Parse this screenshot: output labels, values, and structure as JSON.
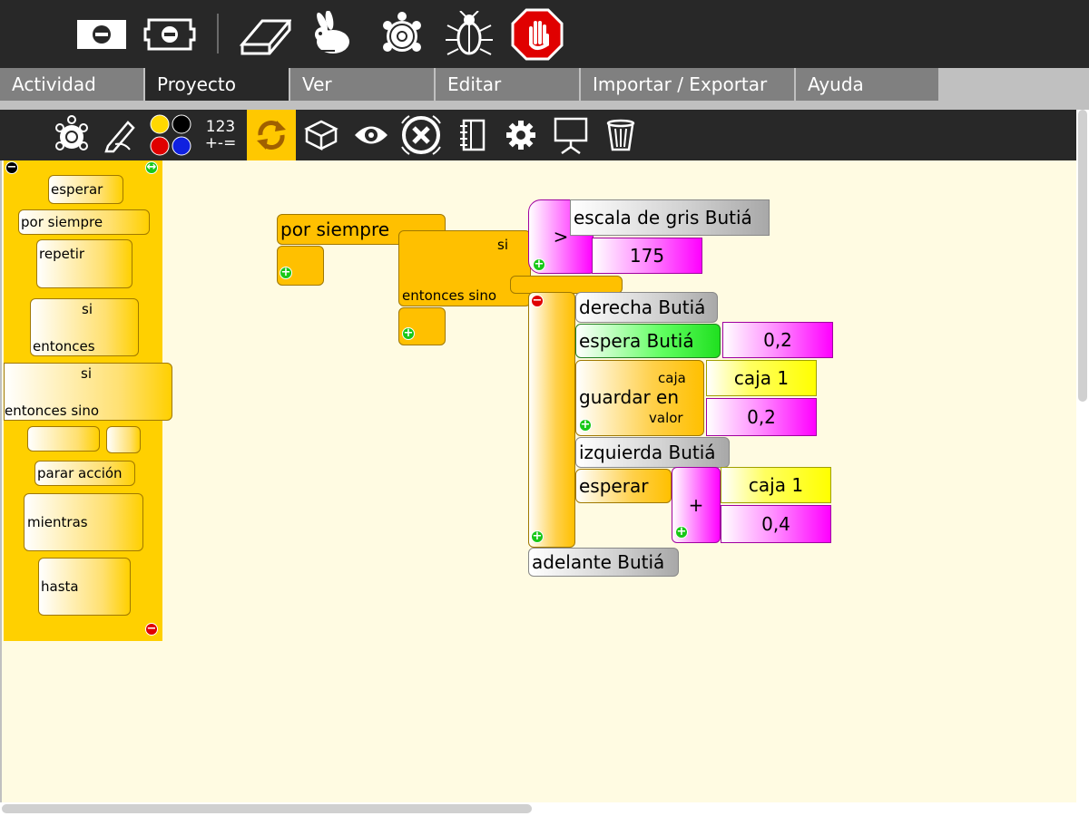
{
  "toolbar": {
    "icons": [
      "activity-minus-icon",
      "activity-share-icon",
      "eraser-icon",
      "rabbit-icon",
      "turtle-icon",
      "bug-icon",
      "stop-hand-icon"
    ]
  },
  "tabs": [
    {
      "label": "Actividad"
    },
    {
      "label": "Proyecto"
    },
    {
      "label": "Ver"
    },
    {
      "label": "Editar"
    },
    {
      "label": "Importar / Exportar"
    },
    {
      "label": "Ayuda"
    }
  ],
  "subtoolbar": {
    "number_label_top": "123",
    "number_label_bottom": "+-="
  },
  "palette": {
    "esperar": "esperar",
    "por_siempre": "por siempre",
    "repetir": "repetir",
    "si": "si",
    "entonces": "entonces",
    "si2": "si",
    "entonces_sino": "entonces sino",
    "parar_accion": "parar acción",
    "mientras": "mientras",
    "hasta": "hasta"
  },
  "program": {
    "forever": "por siempre",
    "if_label": "si",
    "then_else": "entonces sino",
    "sensor_gray": "escala de gris Butiá",
    "compare_op": ">",
    "threshold": "175",
    "right": "derecha Butiá",
    "wait_butia": "espera Butiá",
    "wait_value": "0,2",
    "store_in": "guardar en",
    "box_label": "caja",
    "value_label": "valor",
    "box_name": "caja 1",
    "store_value": "0,2",
    "left": "izquierda Butiá",
    "wait": "esperar",
    "plus_op": "+",
    "add_box": "caja 1",
    "add_value": "0,4",
    "forward": "adelante Butiá"
  },
  "colors": {
    "flow": "#ffc000",
    "palette": "#ffd000",
    "canvas": "#fffbe2",
    "number": "#ff00ff",
    "sensor": "#a8a8a8",
    "box": "#ffff00"
  }
}
